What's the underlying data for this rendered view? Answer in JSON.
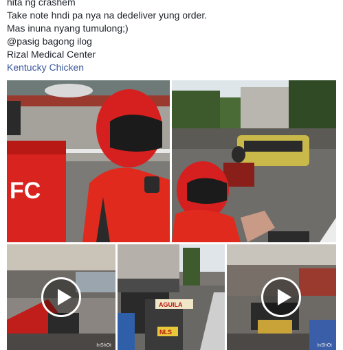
{
  "post": {
    "lines": [
      "hita ng crashem",
      "Take note hndi pa nya na dedeliver yung order.",
      "Mas inuna nyang tumulong;)",
      "@pasig bagong ilog",
      "Rizal Medical Center"
    ],
    "tag": "Kentucky Chicken"
  },
  "photos": {
    "box_logo": "FC",
    "plate_sign": "AGUILA",
    "plate_number": "NLS",
    "watermark": "InShOt"
  },
  "colors": {
    "helmet": "#d61f1f",
    "jacket": "#e02a1e",
    "link": "#385898",
    "jeepney": "#c9b84a"
  }
}
